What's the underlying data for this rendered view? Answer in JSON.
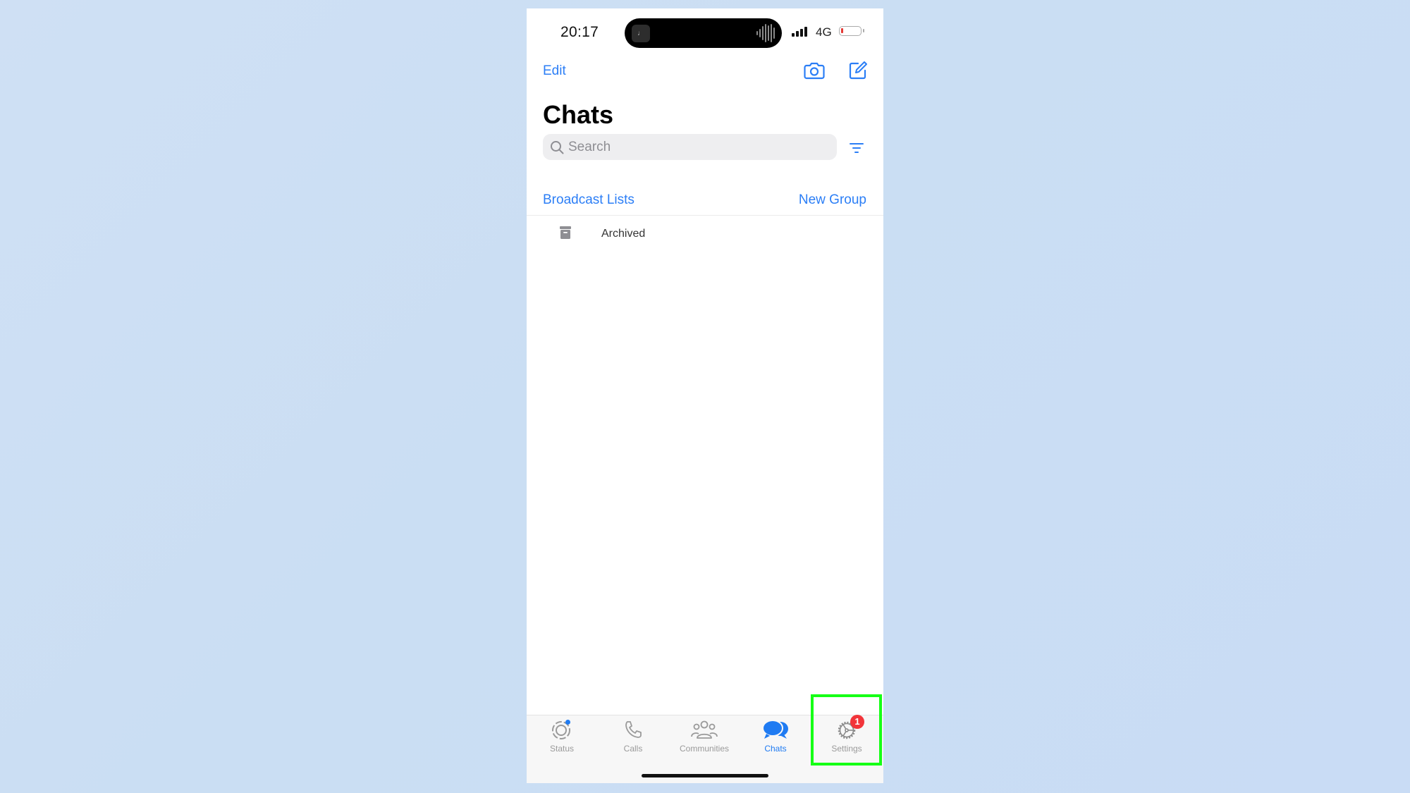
{
  "status_bar": {
    "time": "20:17",
    "network": "4G",
    "battery_level_percent": 8,
    "signal_bars": 4,
    "now_playing_icon": "music-note-icon",
    "now_playing_glyph": "♩"
  },
  "header": {
    "edit_label": "Edit",
    "camera_icon": "camera-icon",
    "compose_icon": "compose-icon",
    "title": "Chats"
  },
  "search": {
    "placeholder": "Search",
    "value": "",
    "filter_icon": "filter-icon"
  },
  "links": {
    "broadcast_label": "Broadcast Lists",
    "new_group_label": "New Group"
  },
  "archived": {
    "label": "Archived",
    "icon": "archive-box-icon"
  },
  "tabbar": {
    "tabs": [
      {
        "label": "Status",
        "icon": "status-icon",
        "active": false,
        "has_dot": true
      },
      {
        "label": "Calls",
        "icon": "phone-icon",
        "active": false
      },
      {
        "label": "Communities",
        "icon": "communities-icon",
        "active": false
      },
      {
        "label": "Chats",
        "icon": "chat-bubbles-icon",
        "active": true
      },
      {
        "label": "Settings",
        "icon": "gear-icon",
        "active": false,
        "badge": "1"
      }
    ]
  },
  "highlight": {
    "target": "Settings",
    "color": "#16ff16"
  },
  "colors": {
    "accent": "#2b7ef6",
    "badge": "#f2343a",
    "background": "#cbdef4"
  }
}
